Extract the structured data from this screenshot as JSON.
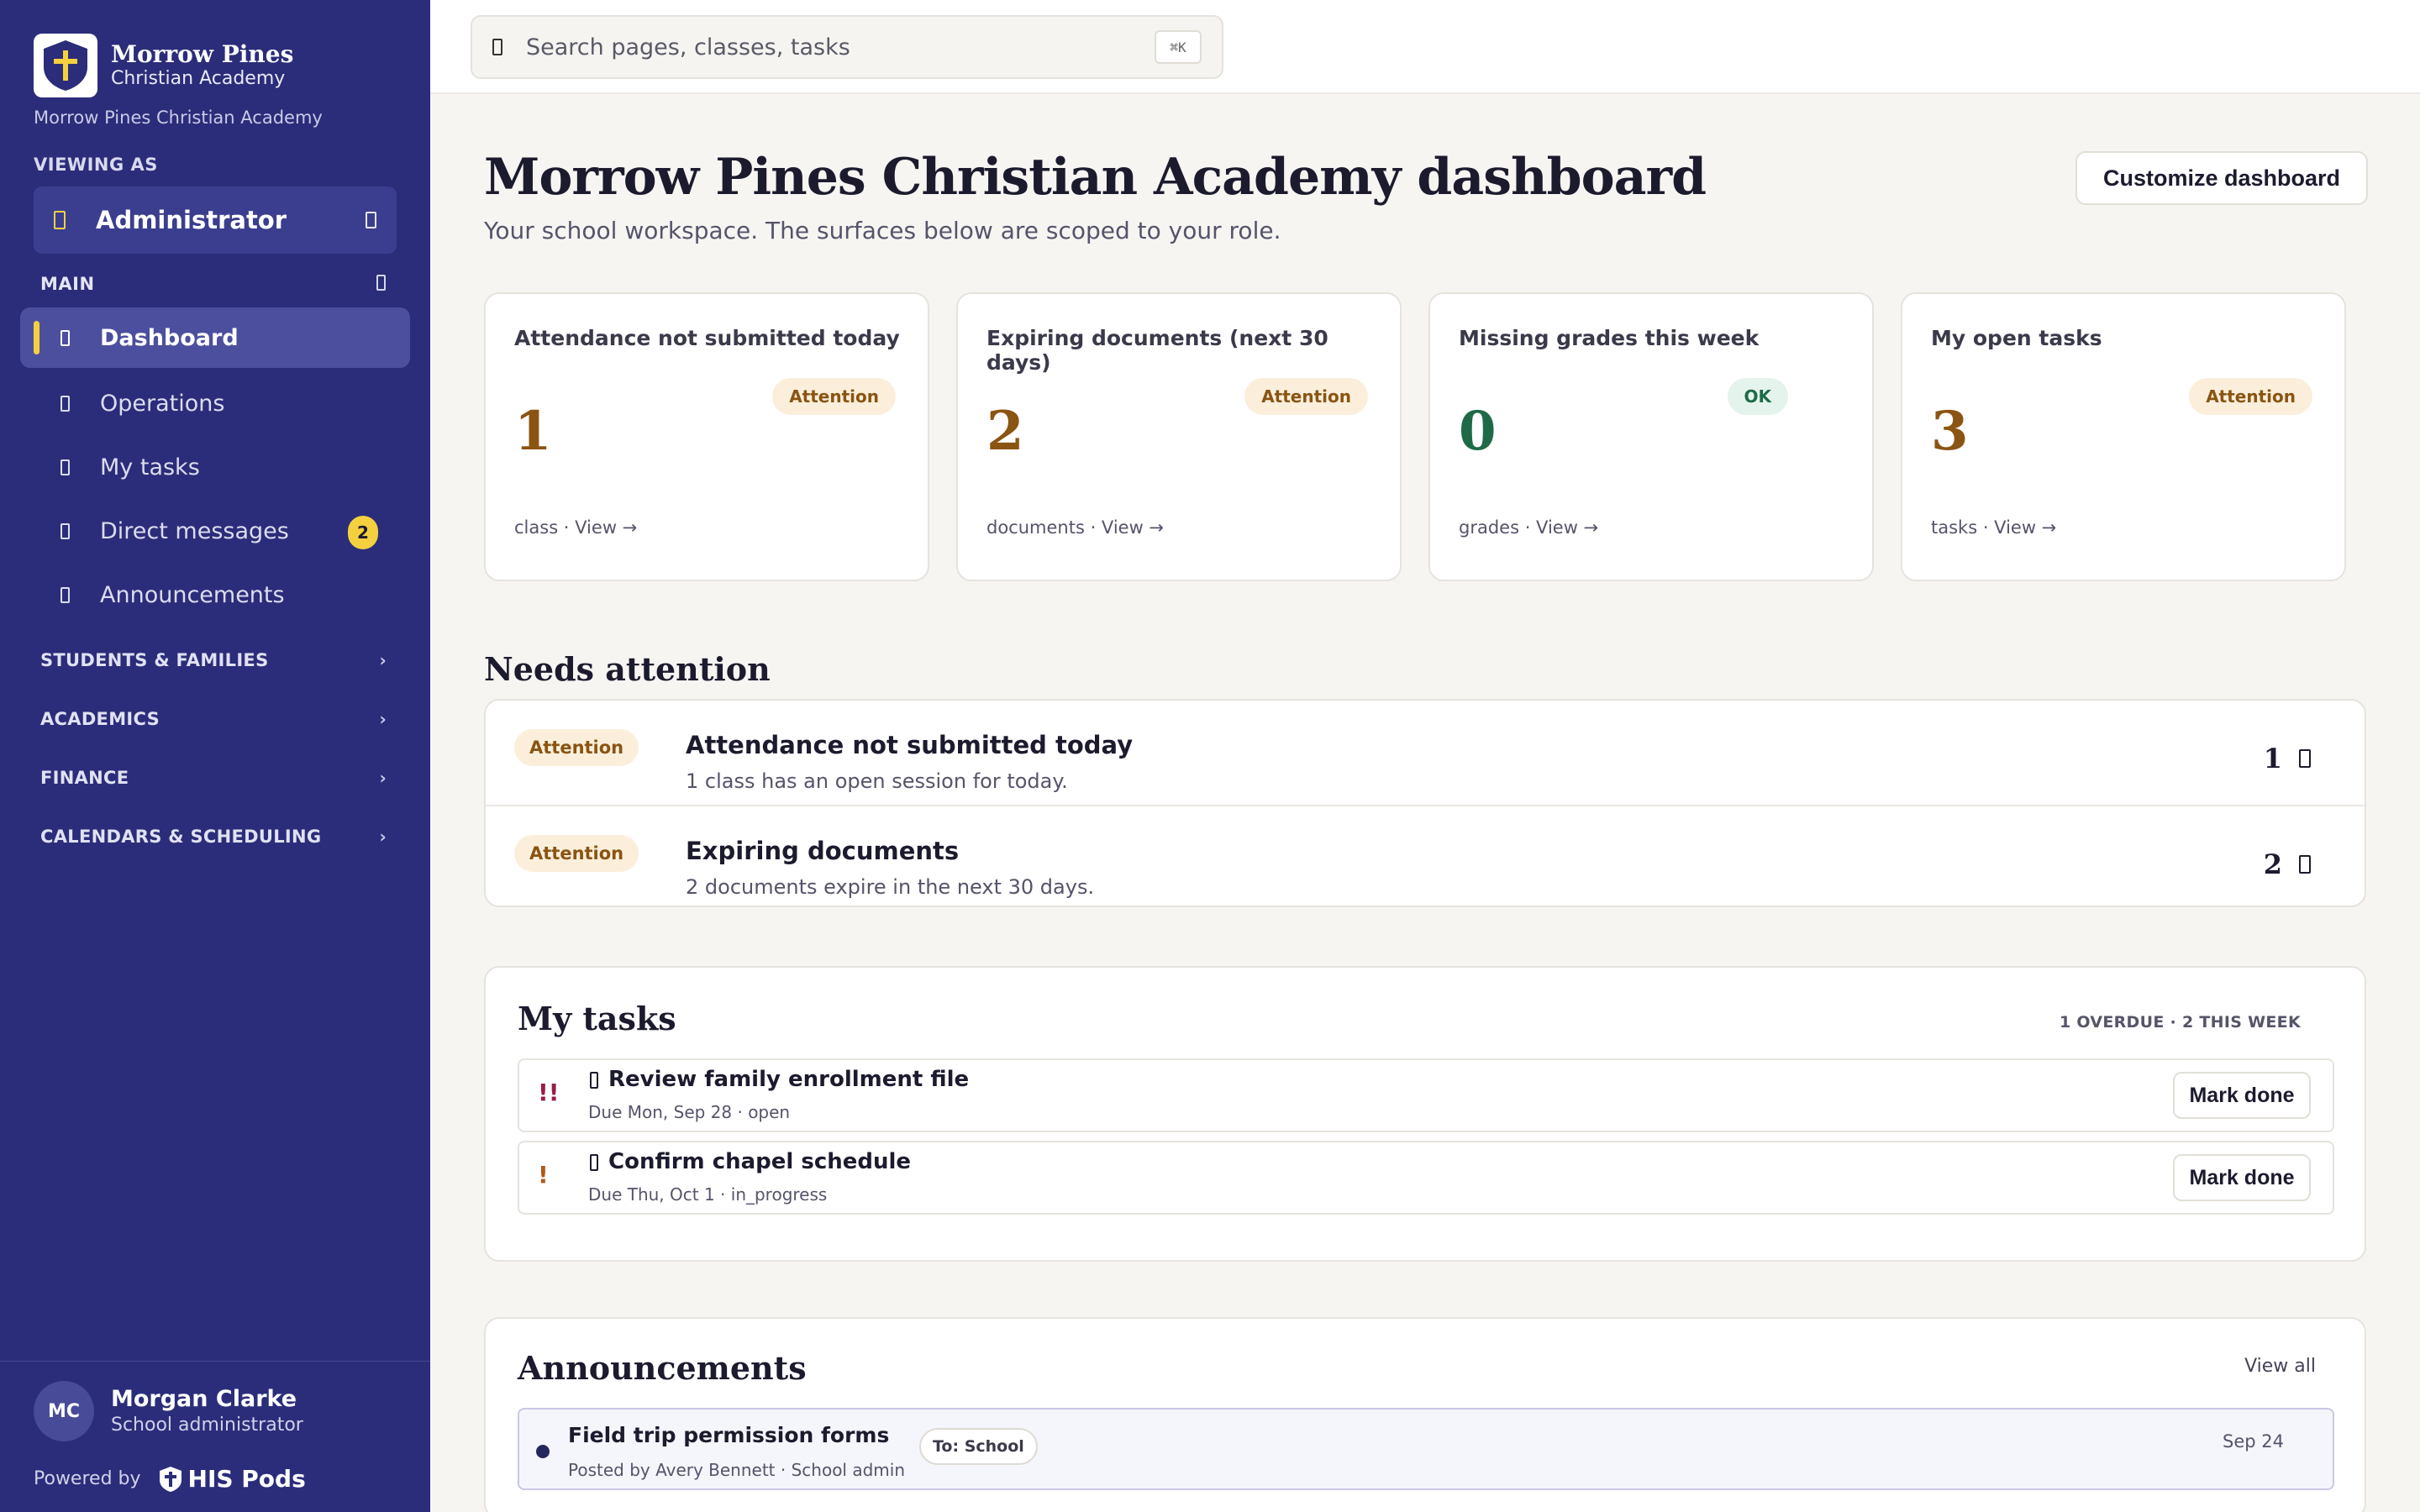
{
  "brand": {
    "name": "Morrow Pines",
    "sub": "Christian Academy",
    "full": "Morrow Pines Christian Academy",
    "accent": "#f4d03f",
    "sidebar_bg": "#2b2d7a"
  },
  "viewing": {
    "label": "VIEWING AS",
    "role": "Administrator"
  },
  "nav": {
    "main_label": "MAIN",
    "items": [
      {
        "label": "Dashboard",
        "icon": "dashboard-icon",
        "active": true
      },
      {
        "label": "Operations",
        "icon": "operations-icon"
      },
      {
        "label": "My tasks",
        "icon": "tasks-icon"
      },
      {
        "label": "Direct messages",
        "icon": "messages-icon",
        "badge": "2"
      },
      {
        "label": "Announcements",
        "icon": "megaphone-icon"
      }
    ],
    "sections": [
      {
        "label": "STUDENTS & FAMILIES"
      },
      {
        "label": "ACADEMICS"
      },
      {
        "label": "FINANCE"
      },
      {
        "label": "CALENDARS & SCHEDULING"
      }
    ]
  },
  "user": {
    "initials": "MC",
    "name": "Morgan Clarke",
    "role": "School administrator"
  },
  "powered": {
    "label": "Powered by",
    "product": "HIS Pods"
  },
  "search": {
    "placeholder": "Search pages, classes, tasks",
    "shortcut": "⌘K"
  },
  "header": {
    "title": "Morrow Pines Christian Academy dashboard",
    "subtitle": "Your school workspace. The surfaces below are scoped to your role.",
    "customize": "Customize dashboard"
  },
  "kpis": [
    {
      "title": "Attendance not submitted today",
      "badge": "Attention",
      "value": "1",
      "footer": "class · View →"
    },
    {
      "title": "Expiring documents (next 30 days)",
      "badge": "Attention",
      "value": "2",
      "footer": "documents · View →"
    },
    {
      "title": "Missing grades this week",
      "badge": "OK",
      "value": "0",
      "footer": "grades · View →"
    },
    {
      "title": "My open tasks",
      "badge": "Attention",
      "value": "3",
      "footer": "tasks · View →"
    }
  ],
  "attention": {
    "heading": "Needs attention",
    "items": [
      {
        "badge": "Attention",
        "title": "Attendance not submitted today",
        "desc": "1 class has an open session for today.",
        "count": "1"
      },
      {
        "badge": "Attention",
        "title": "Expiring documents",
        "desc": "2 documents expire in the next 30 days.",
        "count": "2"
      }
    ]
  },
  "tasks": {
    "heading": "My tasks",
    "meta": "1 OVERDUE · 2 THIS WEEK",
    "items": [
      {
        "priority": "!!",
        "title": "Review family enrollment file",
        "meta": "Due Mon, Sep 28 · open",
        "action": "Mark done"
      },
      {
        "priority": "!",
        "title": "Confirm chapel schedule",
        "meta": "Due Thu, Oct 1 · in_progress",
        "action": "Mark done"
      }
    ]
  },
  "announcements": {
    "heading": "Announcements",
    "view_all": "View all",
    "items": [
      {
        "title": "Field trip permission forms",
        "meta": "Posted by Avery Bennett · School admin",
        "audience": "To: School",
        "date": "Sep 24"
      }
    ]
  },
  "colors": {
    "attention_bg": "#fbefdc",
    "attention_fg": "#8a5412",
    "ok_bg": "#e4f4ec",
    "ok_fg": "#1e6a48",
    "priority_high": "#9b1c4a",
    "priority_med": "#b0591a"
  }
}
